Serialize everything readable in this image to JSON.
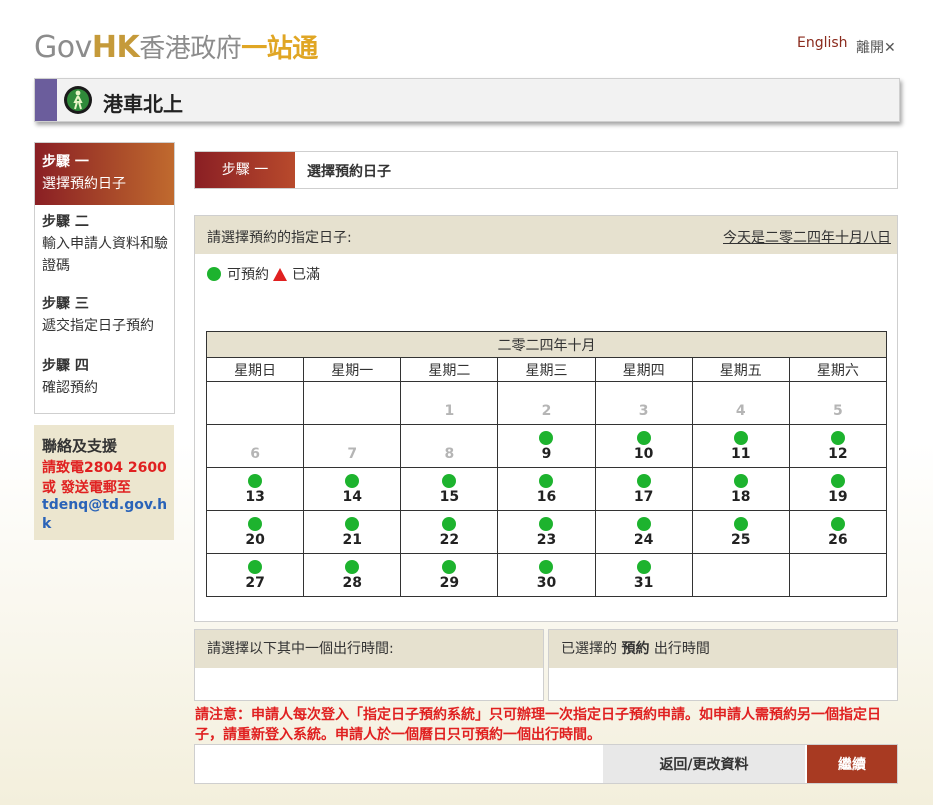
{
  "header": {
    "logo_gov": "Gov",
    "logo_hk": "HK",
    "logo_tc": "香港政府",
    "logo_os": "一站通",
    "lang_link": "English",
    "leave_link": "離開✕"
  },
  "banner": {
    "title": "港車北上",
    "icon": "person-in-circle-icon"
  },
  "sidebar": {
    "steps": [
      {
        "label": "步驟 一",
        "text": "選擇預約日子",
        "active": true
      },
      {
        "label": "步驟 二",
        "text": "輸入申請人資料和驗證碼",
        "active": false
      },
      {
        "label": "步驟 三",
        "text": "遞交指定日子預約",
        "active": false
      },
      {
        "label": "步驟 四",
        "text": "確認預約",
        "active": false
      }
    ],
    "contact": {
      "title": "聯絡及支援",
      "line1": "請致電2804 2600",
      "line2": "或 發送電郵至",
      "email": "tdenq@td.gov.hk"
    }
  },
  "stepbar": {
    "badge": "步驟 一",
    "title": "選擇預約日子"
  },
  "panel": {
    "prompt": "請選擇預約的指定日子:",
    "today": "今天是二零二四年十月八日",
    "legend_available": "可預約",
    "legend_full": "已滿"
  },
  "calendar": {
    "month": "二零二四年十月",
    "weekdays": [
      "星期日",
      "星期一",
      "星期二",
      "星期三",
      "星期四",
      "星期五",
      "星期六"
    ],
    "weeks": [
      [
        null,
        null,
        {
          "d": "1",
          "s": "past"
        },
        {
          "d": "2",
          "s": "past"
        },
        {
          "d": "3",
          "s": "past"
        },
        {
          "d": "4",
          "s": "past"
        },
        {
          "d": "5",
          "s": "past"
        }
      ],
      [
        {
          "d": "6",
          "s": "past"
        },
        {
          "d": "7",
          "s": "past"
        },
        {
          "d": "8",
          "s": "past"
        },
        {
          "d": "9",
          "s": "available"
        },
        {
          "d": "10",
          "s": "available"
        },
        {
          "d": "11",
          "s": "available"
        },
        {
          "d": "12",
          "s": "available"
        }
      ],
      [
        {
          "d": "13",
          "s": "available"
        },
        {
          "d": "14",
          "s": "available"
        },
        {
          "d": "15",
          "s": "available"
        },
        {
          "d": "16",
          "s": "available"
        },
        {
          "d": "17",
          "s": "available"
        },
        {
          "d": "18",
          "s": "available"
        },
        {
          "d": "19",
          "s": "available"
        }
      ],
      [
        {
          "d": "20",
          "s": "available"
        },
        {
          "d": "21",
          "s": "available"
        },
        {
          "d": "22",
          "s": "available"
        },
        {
          "d": "23",
          "s": "available"
        },
        {
          "d": "24",
          "s": "available"
        },
        {
          "d": "25",
          "s": "available"
        },
        {
          "d": "26",
          "s": "available"
        }
      ],
      [
        {
          "d": "27",
          "s": "available"
        },
        {
          "d": "28",
          "s": "available"
        },
        {
          "d": "29",
          "s": "available"
        },
        {
          "d": "30",
          "s": "available"
        },
        {
          "d": "31",
          "s": "available"
        },
        null,
        null
      ]
    ]
  },
  "time": {
    "select_title": "請選擇以下其中一個出行時間:",
    "selected_title_a": "已選擇的",
    "selected_title_b": "預約",
    "selected_title_c": "出行時間"
  },
  "notice": "請注意：申請人每次登入「指定日子預約系統」只可辦理一次指定日子預約申請。如申請人需預約另一個指定日子，請重新登入系統。申請人於一個曆日只可預約一個出行時間。",
  "buttons": {
    "back": "返回/更改資料",
    "next": "繼續"
  },
  "colors": {
    "accent": "#a83a22",
    "available": "#1db32e",
    "full": "#e02020",
    "panel_header": "#e6e1cf"
  }
}
